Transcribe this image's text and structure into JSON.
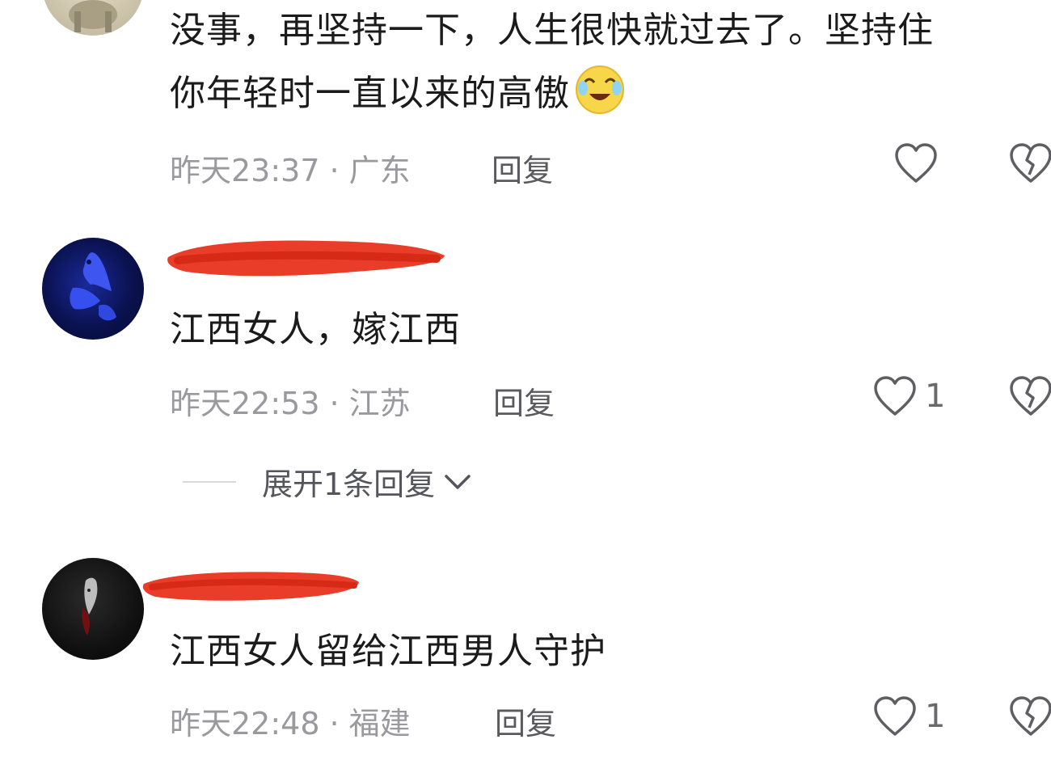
{
  "comments": [
    {
      "text_line1": "没事，再坚持一下，人生很快就过去了。坚持住",
      "text_line2": "你年轻时一直以来的高傲",
      "emoji": "laughing-crying-emoji",
      "time": "昨天23:37",
      "location": "广东",
      "reply_label": "回复",
      "like_count": ""
    },
    {
      "text_line1": "江西女人，嫁江西",
      "time": "昨天22:53",
      "location": "江苏",
      "reply_label": "回复",
      "like_count": "1",
      "expand_label": "展开1条回复"
    },
    {
      "text_line1": "江西女人留给江西男人守护",
      "time": "昨天22:48",
      "location": "福建",
      "reply_label": "回复",
      "like_count": "1"
    }
  ],
  "icons": {
    "like": "heart-outline-icon",
    "dislike": "broken-heart-icon",
    "expand": "chevron-down-icon"
  },
  "colors": {
    "redaction": "#e8321e",
    "meta_text": "#9a9a9e",
    "body_text": "#1b1b1b"
  }
}
